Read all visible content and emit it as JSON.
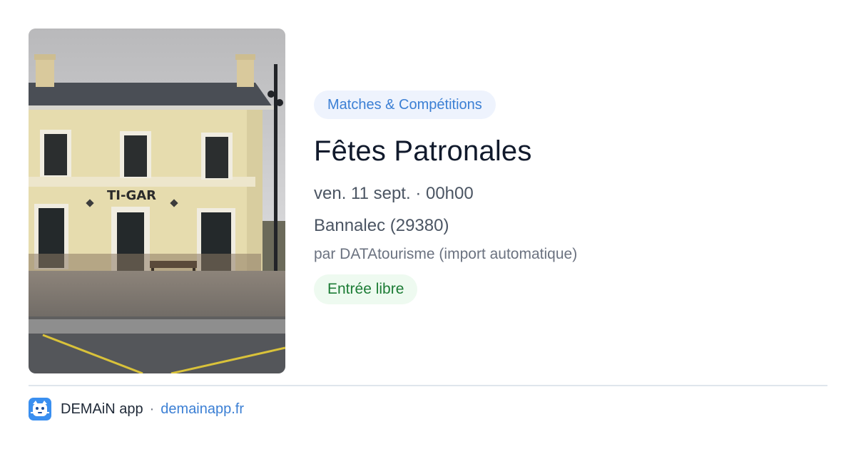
{
  "photo": {
    "alt": "Gare de Bannalec",
    "sign_text": "TI-GAR"
  },
  "event": {
    "category": "Matches & Compétitions",
    "title": "Fêtes Patronales",
    "datetime": "ven. 11 sept. · 00h00",
    "location": "Bannalec (29380)",
    "source": "par DATAtourisme (import automatique)",
    "price": "Entrée libre"
  },
  "footer": {
    "app_name": "DEMAiN app",
    "separator": "·",
    "site": "demainapp.fr"
  },
  "colors": {
    "category_text": "#3b7fd4",
    "category_bg": "#eef3fd",
    "price_text": "#1c7c35",
    "price_bg": "#eefaf0",
    "link": "#3b7fd4",
    "logo_bg": "#3a8ff0"
  }
}
